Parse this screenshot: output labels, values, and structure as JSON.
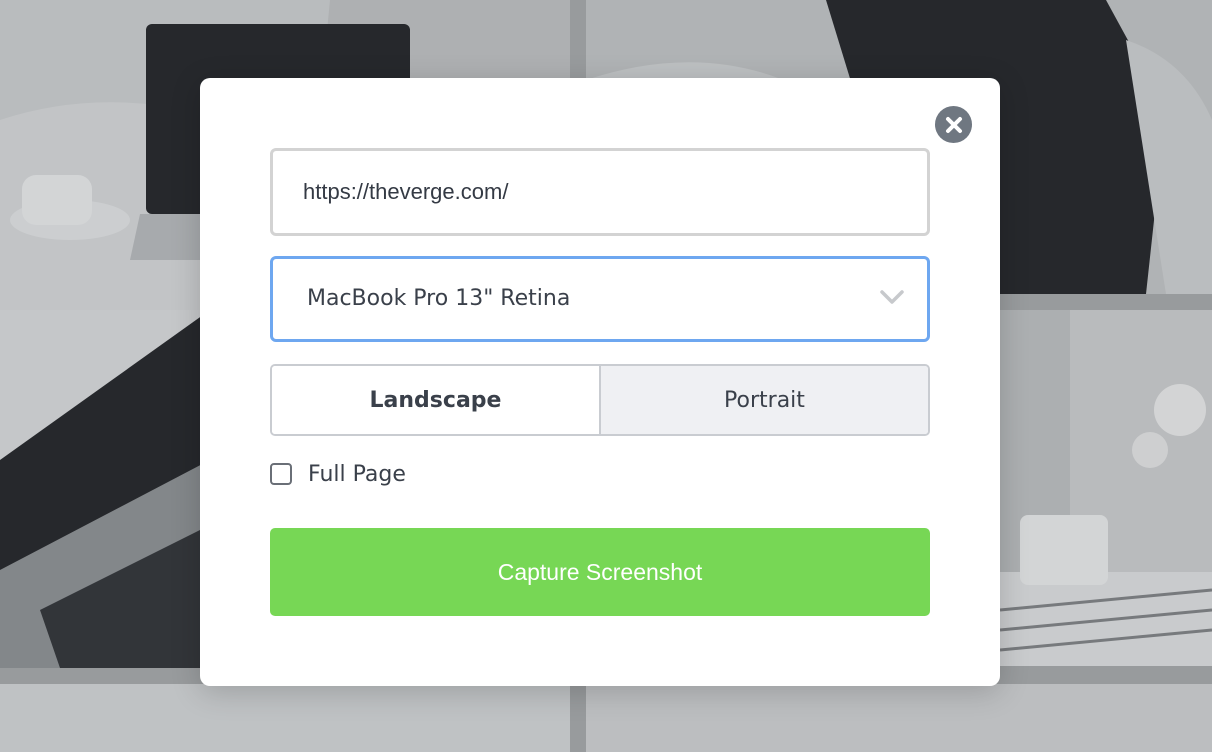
{
  "colors": {
    "accent_focus": "#6ea7f0",
    "capture_button": "#77d755",
    "close_button": "#6f7781"
  },
  "modal": {
    "close_icon": "close-icon",
    "url": {
      "value": "https://theverge.com/"
    },
    "device": {
      "selected": "MacBook Pro 13\" Retina",
      "icon": "chevron-down-icon"
    },
    "orientation": {
      "landscape_label": "Landscape",
      "portrait_label": "Portrait",
      "selected": "Landscape"
    },
    "full_page": {
      "label": "Full Page",
      "checked": false
    },
    "capture_label": "Capture Screenshot"
  }
}
